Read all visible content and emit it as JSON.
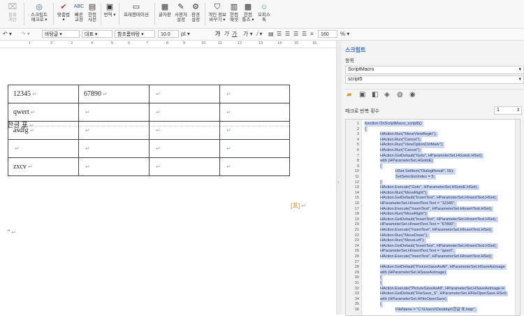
{
  "ribbon": {
    "items": [
      {
        "name": "block-calc",
        "icon": "⌧",
        "label1": "블록",
        "label2": "계산"
      },
      {
        "name": "script-macro",
        "icon": "◎",
        "label1": "스크립트",
        "label2": "매크로"
      },
      {
        "name": "spellcheck",
        "icon": "✔",
        "label1": "맞춤법",
        "label2": ""
      },
      {
        "name": "quick-correct",
        "icon": "ABC",
        "label1": "빠른",
        "label2": "교정"
      },
      {
        "name": "edit-dictionary",
        "icon": "▤",
        "label1": "한컴",
        "label2": "사전"
      },
      {
        "name": "translate",
        "icon": "▣",
        "label1": "번역",
        "label2": ""
      },
      {
        "name": "presentation",
        "icon": "▭",
        "label1": "프레젠테이션",
        "label2": ""
      },
      {
        "name": "glyph-table",
        "icon": "▦",
        "label1": "글자판",
        "label2": ""
      },
      {
        "name": "user-settings",
        "icon": "✎",
        "label1": "사용자",
        "label2": "설정"
      },
      {
        "name": "env-settings",
        "icon": "⚙",
        "label1": "환경",
        "label2": "설정"
      },
      {
        "name": "privacy-convert",
        "icon": "⛉",
        "label1": "개인 정보",
        "label2": "바꾸기"
      },
      {
        "name": "hancom-assets",
        "icon": "▥",
        "label1": "한컴",
        "label2": "애셋"
      },
      {
        "name": "hancom-tools",
        "icon": "▩",
        "label1": "한컴",
        "label2": "툴즈"
      },
      {
        "name": "office-tok",
        "icon": "☺",
        "label1": "오피스",
        "label2": "톡"
      }
    ]
  },
  "format": {
    "style": "바탕글",
    "lang": "대표",
    "font": "함초롬바탕",
    "size": "10.0",
    "size_unit": "pt",
    "zoom": "160",
    "zoom_unit": "%"
  },
  "ruler": {
    "ticks": [
      "1",
      "2",
      "3",
      "4",
      "5",
      "6",
      "7",
      "8",
      "9",
      "10",
      "11",
      "12",
      "13",
      "14",
      "15",
      "16"
    ]
  },
  "document": {
    "heading": "한글 표",
    "rows": [
      [
        "12345",
        "67890",
        "",
        ""
      ],
      [
        "qwert",
        "",
        "",
        ""
      ],
      [
        "asdfg",
        "",
        "",
        ""
      ],
      [
        "",
        "",
        "",
        ""
      ],
      [
        "zxcv",
        "",
        "",
        ""
      ]
    ],
    "caption_tag": "[표]",
    "para_mark": "↵"
  },
  "panel": {
    "title": "스크립트",
    "section_label": "항목",
    "dropdown1": "ScriptMacro",
    "dropdown2": "script5",
    "repeat_label": "매크로 반복 횟수",
    "repeat_value": "1",
    "code": [
      "function OnScriptMacro_script5()",
      "{",
      "HAction.Run(\"MoveViewBegin\");",
      "HAction.Run(\"Cancel\");",
      "HAction.Run(\"ViewOptionCtrlMark\");",
      "HAction.Run(\"Cancel\");",
      "HAction.GetDefault(\"Goto\", HParameterSet.HGotoE.HSet);",
      "with (HParameterSet.HGotoE)",
      "{",
      "HSet.SetItem(\"DialogResult\", 55);",
      "SetSelectionIndex = 5;",
      "}",
      "HAction.Execute(\"Goto\", HParameterSet.HGotoE.HSet);",
      "HAction.Run(\"MoveRight\");",
      "HAction.GetDefault(\"InsertText\", HParameterSet.HInsertText.HSet);",
      "HParameterSet.HInsertText.Text = \"12345\";",
      "HAction.Execute(\"InsertText\", HParameterSet.HInsertText.HSet);",
      "HAction.Run(\"MoveRight\");",
      "HAction.GetDefault(\"InsertText\", HParameterSet.HInsertText.HSet);",
      "HParameterSet.HInsertText.Text = \"67890\";",
      "HAction.Execute(\"InsertText\", HParameterSet.HInsertText.HSet);",
      "HAction.Run(\"MoveDown\");",
      "HAction.Run(\"MoveLeft\");",
      "HAction.GetDefault(\"InsertText\", HParameterSet.HInsertText.HSet);",
      "HParameterSet.HInsertText.Text = \"qwert\";",
      "HAction.Execute(\"InsertText\", HParameterSet.HInsertText.HSet);",
      "",
      "HAction.GetDefault(\"PictureSaveAsAll\", HParameterSet.HSaveAsImage",
      "with (HParameterSet.HSaveAsImage)",
      "{",
      "}",
      "HAction.Execute(\"PictureSaveAsAll\", HParameterSet.HSaveAsImage.H",
      "HAction.GetDefault(\"FileSave_S\", HParameterSet.HFileOpenSave.HSet)",
      "with (HParameterSet.HFileOpenSave)",
      "{",
      "FileName = \"C:\\\\Users\\\\Desktop\\\\한글 표.hwp\";"
    ]
  }
}
